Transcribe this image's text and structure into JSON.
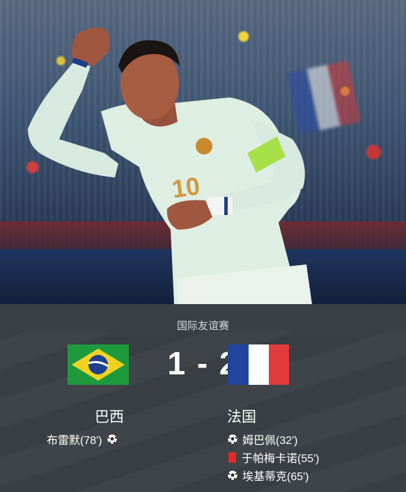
{
  "match": {
    "competition": "国际友谊赛",
    "score": "1 - 2",
    "home": {
      "name": "巴西",
      "flag": "flag-brazil"
    },
    "away": {
      "name": "法国",
      "flag": "flag-france"
    }
  },
  "events": {
    "home": [
      {
        "type": "goal",
        "text": "布雷默(78')"
      }
    ],
    "away": [
      {
        "type": "goal",
        "text": "姆巴佩(32')"
      },
      {
        "type": "red-card",
        "text": "于帕梅卡诺(55')"
      },
      {
        "type": "goal",
        "text": "埃基蒂克(65')"
      }
    ]
  },
  "colors": {
    "panel_bg": "#3a4046",
    "jersey": "#dfeee3",
    "armband": "#a8e04a",
    "red_card": "#e02b2b"
  }
}
